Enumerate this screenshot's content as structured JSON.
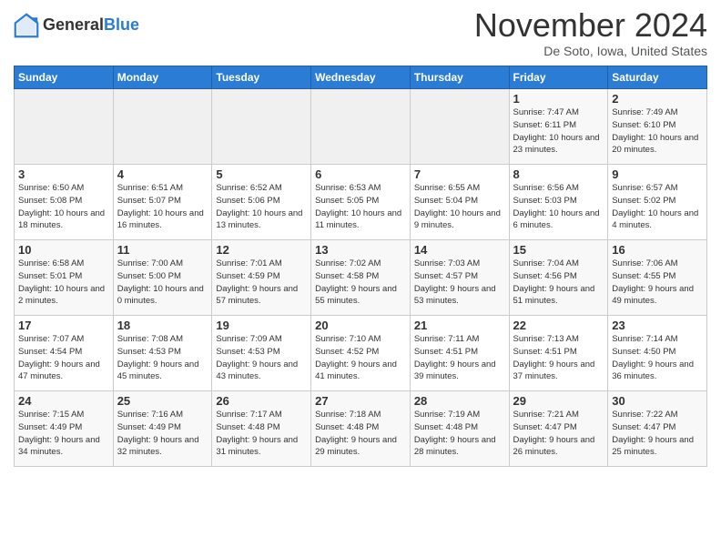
{
  "header": {
    "logo_line1": "General",
    "logo_line2": "Blue",
    "month": "November 2024",
    "location": "De Soto, Iowa, United States"
  },
  "weekdays": [
    "Sunday",
    "Monday",
    "Tuesday",
    "Wednesday",
    "Thursday",
    "Friday",
    "Saturday"
  ],
  "weeks": [
    [
      {
        "day": "",
        "info": ""
      },
      {
        "day": "",
        "info": ""
      },
      {
        "day": "",
        "info": ""
      },
      {
        "day": "",
        "info": ""
      },
      {
        "day": "",
        "info": ""
      },
      {
        "day": "1",
        "info": "Sunrise: 7:47 AM\nSunset: 6:11 PM\nDaylight: 10 hours and 23 minutes."
      },
      {
        "day": "2",
        "info": "Sunrise: 7:49 AM\nSunset: 6:10 PM\nDaylight: 10 hours and 20 minutes."
      }
    ],
    [
      {
        "day": "3",
        "info": "Sunrise: 6:50 AM\nSunset: 5:08 PM\nDaylight: 10 hours and 18 minutes."
      },
      {
        "day": "4",
        "info": "Sunrise: 6:51 AM\nSunset: 5:07 PM\nDaylight: 10 hours and 16 minutes."
      },
      {
        "day": "5",
        "info": "Sunrise: 6:52 AM\nSunset: 5:06 PM\nDaylight: 10 hours and 13 minutes."
      },
      {
        "day": "6",
        "info": "Sunrise: 6:53 AM\nSunset: 5:05 PM\nDaylight: 10 hours and 11 minutes."
      },
      {
        "day": "7",
        "info": "Sunrise: 6:55 AM\nSunset: 5:04 PM\nDaylight: 10 hours and 9 minutes."
      },
      {
        "day": "8",
        "info": "Sunrise: 6:56 AM\nSunset: 5:03 PM\nDaylight: 10 hours and 6 minutes."
      },
      {
        "day": "9",
        "info": "Sunrise: 6:57 AM\nSunset: 5:02 PM\nDaylight: 10 hours and 4 minutes."
      }
    ],
    [
      {
        "day": "10",
        "info": "Sunrise: 6:58 AM\nSunset: 5:01 PM\nDaylight: 10 hours and 2 minutes."
      },
      {
        "day": "11",
        "info": "Sunrise: 7:00 AM\nSunset: 5:00 PM\nDaylight: 10 hours and 0 minutes."
      },
      {
        "day": "12",
        "info": "Sunrise: 7:01 AM\nSunset: 4:59 PM\nDaylight: 9 hours and 57 minutes."
      },
      {
        "day": "13",
        "info": "Sunrise: 7:02 AM\nSunset: 4:58 PM\nDaylight: 9 hours and 55 minutes."
      },
      {
        "day": "14",
        "info": "Sunrise: 7:03 AM\nSunset: 4:57 PM\nDaylight: 9 hours and 53 minutes."
      },
      {
        "day": "15",
        "info": "Sunrise: 7:04 AM\nSunset: 4:56 PM\nDaylight: 9 hours and 51 minutes."
      },
      {
        "day": "16",
        "info": "Sunrise: 7:06 AM\nSunset: 4:55 PM\nDaylight: 9 hours and 49 minutes."
      }
    ],
    [
      {
        "day": "17",
        "info": "Sunrise: 7:07 AM\nSunset: 4:54 PM\nDaylight: 9 hours and 47 minutes."
      },
      {
        "day": "18",
        "info": "Sunrise: 7:08 AM\nSunset: 4:53 PM\nDaylight: 9 hours and 45 minutes."
      },
      {
        "day": "19",
        "info": "Sunrise: 7:09 AM\nSunset: 4:53 PM\nDaylight: 9 hours and 43 minutes."
      },
      {
        "day": "20",
        "info": "Sunrise: 7:10 AM\nSunset: 4:52 PM\nDaylight: 9 hours and 41 minutes."
      },
      {
        "day": "21",
        "info": "Sunrise: 7:11 AM\nSunset: 4:51 PM\nDaylight: 9 hours and 39 minutes."
      },
      {
        "day": "22",
        "info": "Sunrise: 7:13 AM\nSunset: 4:51 PM\nDaylight: 9 hours and 37 minutes."
      },
      {
        "day": "23",
        "info": "Sunrise: 7:14 AM\nSunset: 4:50 PM\nDaylight: 9 hours and 36 minutes."
      }
    ],
    [
      {
        "day": "24",
        "info": "Sunrise: 7:15 AM\nSunset: 4:49 PM\nDaylight: 9 hours and 34 minutes."
      },
      {
        "day": "25",
        "info": "Sunrise: 7:16 AM\nSunset: 4:49 PM\nDaylight: 9 hours and 32 minutes."
      },
      {
        "day": "26",
        "info": "Sunrise: 7:17 AM\nSunset: 4:48 PM\nDaylight: 9 hours and 31 minutes."
      },
      {
        "day": "27",
        "info": "Sunrise: 7:18 AM\nSunset: 4:48 PM\nDaylight: 9 hours and 29 minutes."
      },
      {
        "day": "28",
        "info": "Sunrise: 7:19 AM\nSunset: 4:48 PM\nDaylight: 9 hours and 28 minutes."
      },
      {
        "day": "29",
        "info": "Sunrise: 7:21 AM\nSunset: 4:47 PM\nDaylight: 9 hours and 26 minutes."
      },
      {
        "day": "30",
        "info": "Sunrise: 7:22 AM\nSunset: 4:47 PM\nDaylight: 9 hours and 25 minutes."
      }
    ]
  ]
}
